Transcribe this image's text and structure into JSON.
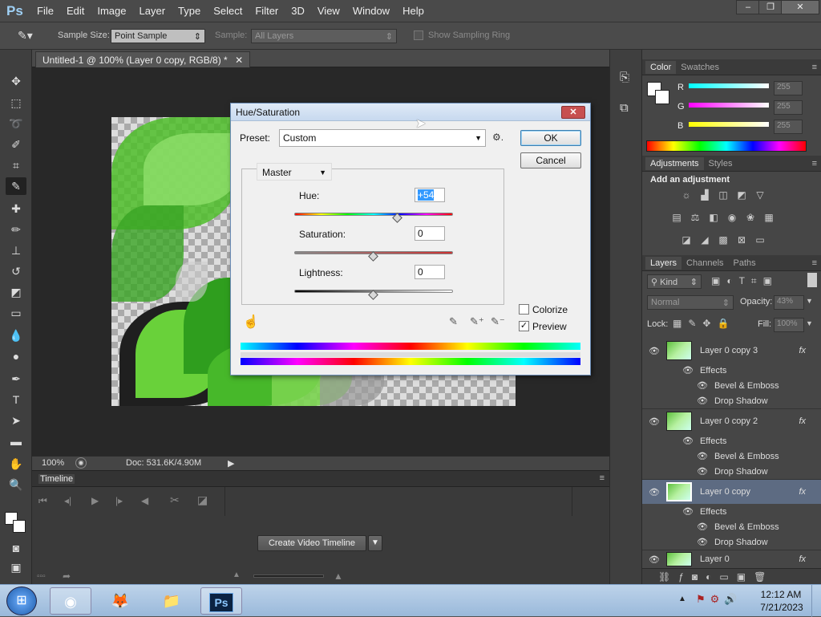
{
  "app": {
    "logo": "Ps"
  },
  "menu": [
    "File",
    "Edit",
    "Image",
    "Layer",
    "Type",
    "Select",
    "Filter",
    "3D",
    "View",
    "Window",
    "Help"
  ],
  "options": {
    "sample_size_label": "Sample Size:",
    "sample_size_value": "Point Sample",
    "sample_label": "Sample:",
    "sample_value": "All Layers",
    "show_ring_label": "Show Sampling Ring"
  },
  "document": {
    "tab_title": "Untitled-1 @ 100% (Layer 0 copy, RGB/8) *",
    "zoom": "100%",
    "doc_info": "Doc: 531.6K/4.90M"
  },
  "timeline": {
    "title": "Timeline",
    "create_button": "Create Video Timeline"
  },
  "color_panel": {
    "tabs": [
      "Color",
      "Swatches"
    ],
    "r_label": "R",
    "g_label": "G",
    "b_label": "B",
    "r_value": "255",
    "g_value": "255",
    "b_value": "255"
  },
  "adjustments_panel": {
    "tabs": [
      "Adjustments",
      "Styles"
    ],
    "heading": "Add an adjustment"
  },
  "layers_panel": {
    "tabs": [
      "Layers",
      "Channels",
      "Paths"
    ],
    "kind": "Kind",
    "blend_mode": "Normal",
    "opacity_label": "Opacity:",
    "opacity_value": "43%",
    "lock_label": "Lock:",
    "fill_label": "Fill:",
    "fill_value": "100%",
    "layers": [
      {
        "name": "Layer 0 copy 3",
        "effects": "Effects",
        "fx1": "Bevel & Emboss",
        "fx2": "Drop Shadow"
      },
      {
        "name": "Layer 0 copy 2",
        "effects": "Effects",
        "fx1": "Bevel & Emboss",
        "fx2": "Drop Shadow"
      },
      {
        "name": "Layer 0 copy",
        "effects": "Effects",
        "fx1": "Bevel & Emboss",
        "fx2": "Drop Shadow"
      },
      {
        "name": "Layer 0"
      }
    ]
  },
  "dialog": {
    "title": "Hue/Saturation",
    "preset_label": "Preset:",
    "preset_value": "Custom",
    "ok_label": "OK",
    "cancel_label": "Cancel",
    "channel_value": "Master",
    "hue_label": "Hue:",
    "hue_value": "+54",
    "saturation_label": "Saturation:",
    "saturation_value": "0",
    "lightness_label": "Lightness:",
    "lightness_value": "0",
    "colorize_label": "Colorize",
    "preview_label": "Preview",
    "hue_slider": 0.65,
    "saturation_slider": 0.5,
    "lightness_slider": 0.5
  },
  "taskbar": {
    "time": "12:12 AM",
    "date": "7/21/2023"
  }
}
